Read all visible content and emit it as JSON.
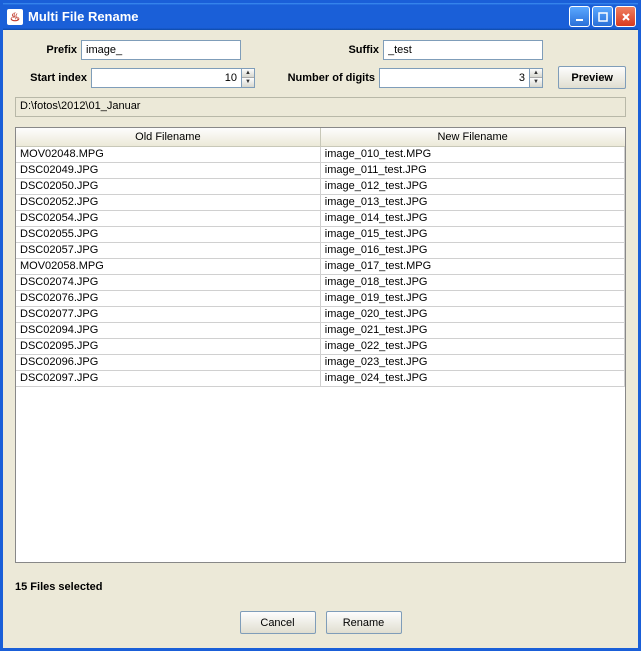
{
  "window": {
    "title": "Multi File Rename"
  },
  "form": {
    "prefix_label": "Prefix",
    "prefix_value": "image_",
    "suffix_label": "Suffix",
    "suffix_value": "_test",
    "start_index_label": "Start index",
    "start_index_value": "10",
    "digits_label": "Number of digits",
    "digits_value": "3",
    "preview_label": "Preview"
  },
  "path": "D:\\fotos\\2012\\01_Januar",
  "table": {
    "col_old": "Old Filename",
    "col_new": "New Filename",
    "rows": [
      {
        "old": "MOV02048.MPG",
        "new": "image_010_test.MPG"
      },
      {
        "old": "DSC02049.JPG",
        "new": "image_011_test.JPG"
      },
      {
        "old": "DSC02050.JPG",
        "new": "image_012_test.JPG"
      },
      {
        "old": "DSC02052.JPG",
        "new": "image_013_test.JPG"
      },
      {
        "old": "DSC02054.JPG",
        "new": "image_014_test.JPG"
      },
      {
        "old": "DSC02055.JPG",
        "new": "image_015_test.JPG"
      },
      {
        "old": "DSC02057.JPG",
        "new": "image_016_test.JPG"
      },
      {
        "old": "MOV02058.MPG",
        "new": "image_017_test.MPG"
      },
      {
        "old": "DSC02074.JPG",
        "new": "image_018_test.JPG"
      },
      {
        "old": "DSC02076.JPG",
        "new": "image_019_test.JPG"
      },
      {
        "old": "DSC02077.JPG",
        "new": "image_020_test.JPG"
      },
      {
        "old": "DSC02094.JPG",
        "new": "image_021_test.JPG"
      },
      {
        "old": "DSC02095.JPG",
        "new": "image_022_test.JPG"
      },
      {
        "old": "DSC02096.JPG",
        "new": "image_023_test.JPG"
      },
      {
        "old": "DSC02097.JPG",
        "new": "image_024_test.JPG"
      }
    ]
  },
  "status": "15 Files selected",
  "footer": {
    "cancel": "Cancel",
    "rename": "Rename"
  }
}
